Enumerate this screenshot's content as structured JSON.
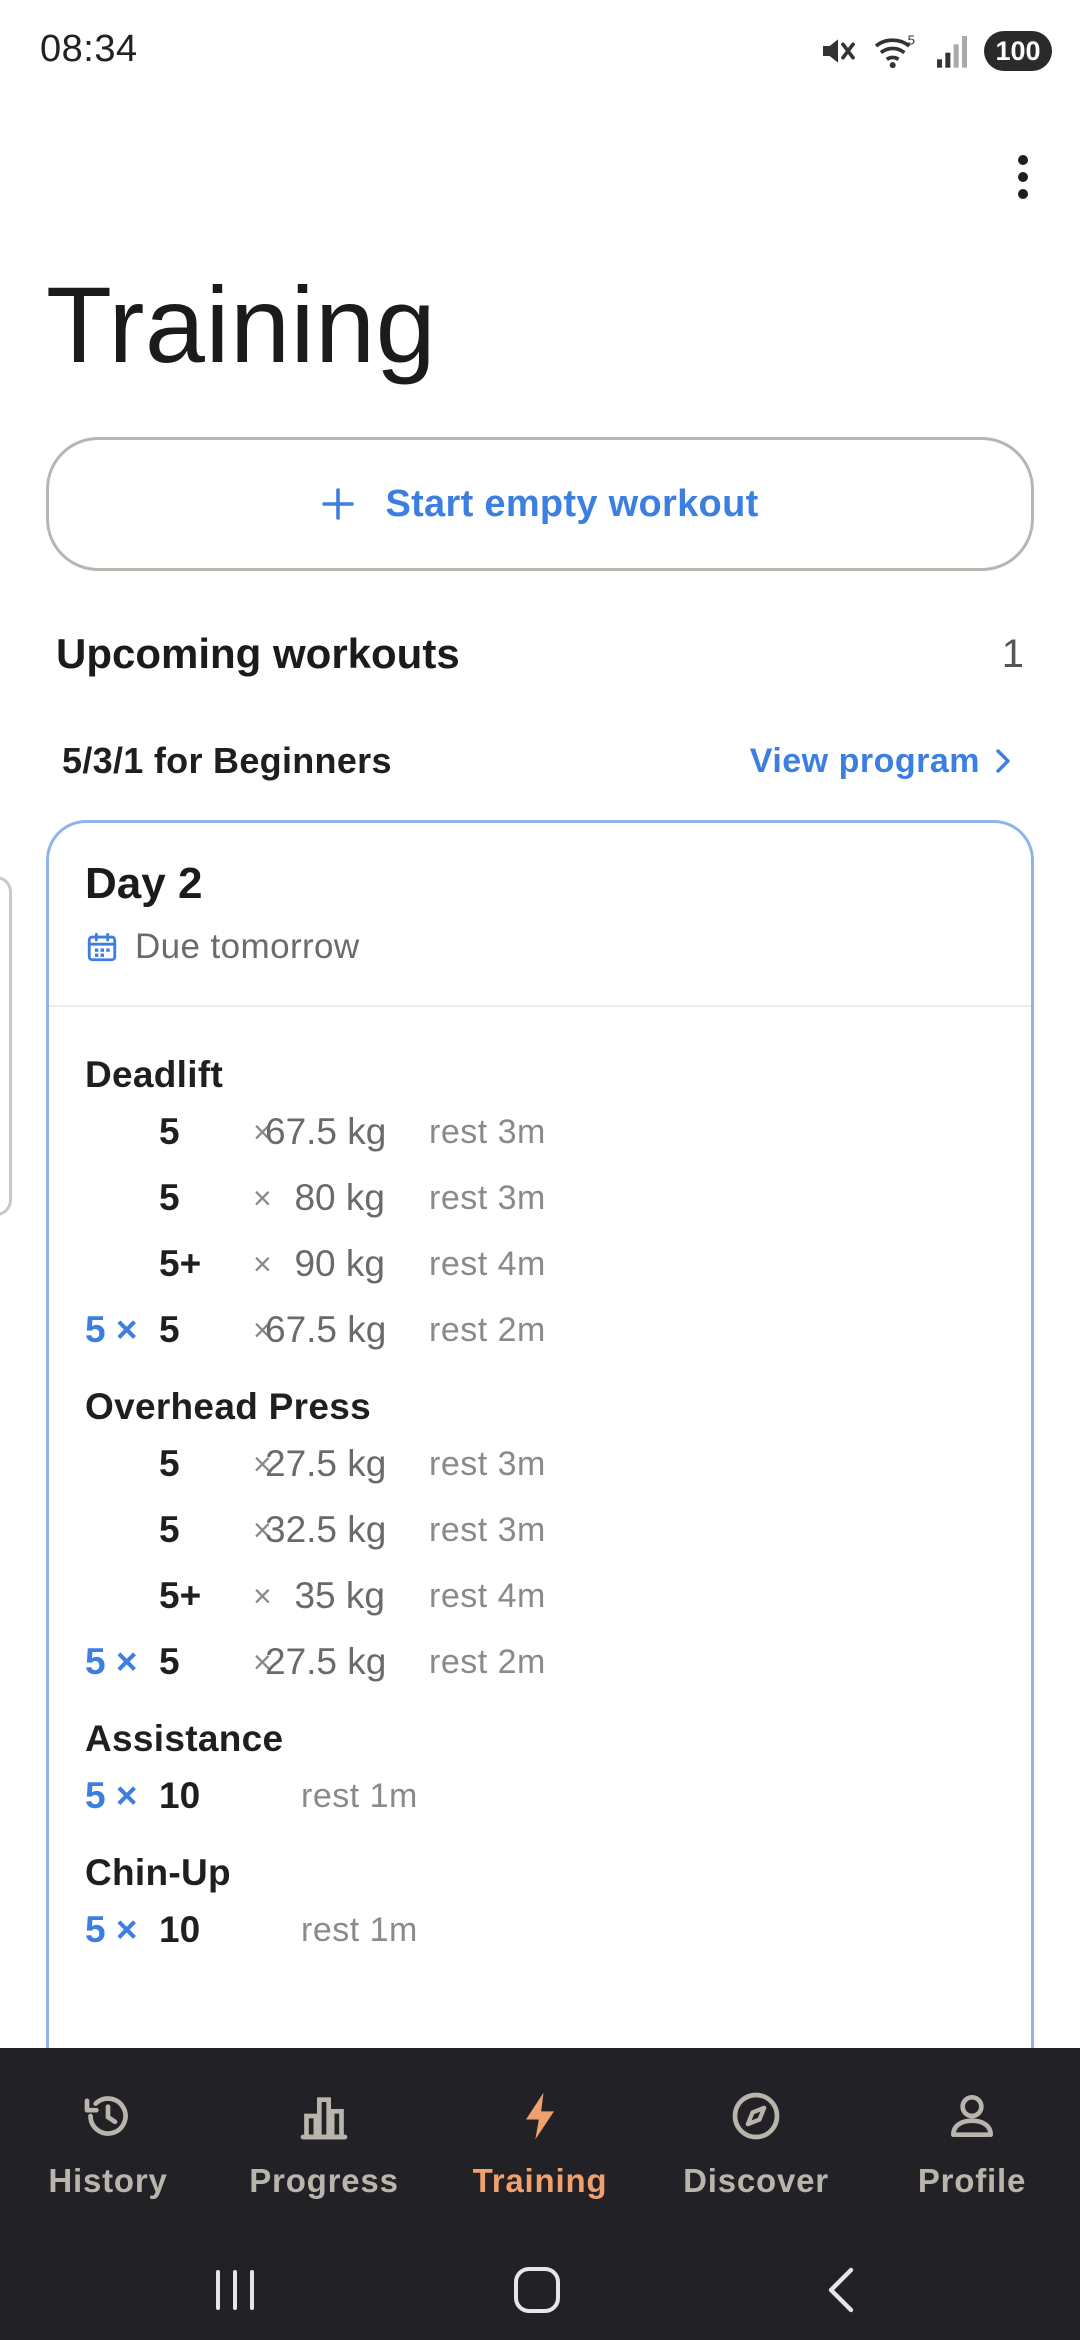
{
  "status_bar": {
    "time": "08:34",
    "battery": "100",
    "wifi_badge": "5"
  },
  "header": {
    "title": "Training"
  },
  "start_workout": {
    "label": "Start empty workout"
  },
  "upcoming": {
    "title": "Upcoming workouts",
    "count": "1"
  },
  "program": {
    "name": "5/3/1 for Beginners",
    "view_label": "View program"
  },
  "card": {
    "day": "Day 2",
    "due": "Due tomorrow",
    "exercises": [
      {
        "name": "Deadlift",
        "sets": [
          {
            "mult": "",
            "reps": "5",
            "x": "×",
            "weight": "67.5 kg",
            "rest": "rest 3m"
          },
          {
            "mult": "",
            "reps": "5",
            "x": "×",
            "weight": "80 kg",
            "rest": "rest 3m"
          },
          {
            "mult": "",
            "reps": "5+",
            "x": "×",
            "weight": "90 kg",
            "rest": "rest 4m"
          },
          {
            "mult": "5 ×",
            "reps": "5",
            "x": "×",
            "weight": "67.5 kg",
            "rest": "rest 2m"
          }
        ]
      },
      {
        "name": "Overhead Press",
        "sets": [
          {
            "mult": "",
            "reps": "5",
            "x": "×",
            "weight": "27.5 kg",
            "rest": "rest 3m"
          },
          {
            "mult": "",
            "reps": "5",
            "x": "×",
            "weight": "32.5 kg",
            "rest": "rest 3m"
          },
          {
            "mult": "",
            "reps": "5+",
            "x": "×",
            "weight": "35 kg",
            "rest": "rest 4m"
          },
          {
            "mult": "5 ×",
            "reps": "5",
            "x": "×",
            "weight": "27.5 kg",
            "rest": "rest 2m"
          }
        ]
      },
      {
        "name": "Assistance",
        "sets": [
          {
            "mult": "5 ×",
            "reps": "10",
            "rest": "rest 1m"
          }
        ]
      },
      {
        "name": "Chin-Up",
        "sets": [
          {
            "mult": "5 ×",
            "reps": "10",
            "rest": "rest 1m"
          }
        ]
      }
    ]
  },
  "bottom_nav": {
    "items": [
      {
        "label": "History",
        "icon": "history-icon"
      },
      {
        "label": "Progress",
        "icon": "bar-chart-icon"
      },
      {
        "label": "Training",
        "icon": "lightning-icon",
        "active": true
      },
      {
        "label": "Discover",
        "icon": "compass-icon"
      },
      {
        "label": "Profile",
        "icon": "person-icon"
      }
    ]
  },
  "colors": {
    "accent": "#3d7fe0",
    "active_nav": "#f0a06e",
    "nav_bg": "#222226"
  }
}
